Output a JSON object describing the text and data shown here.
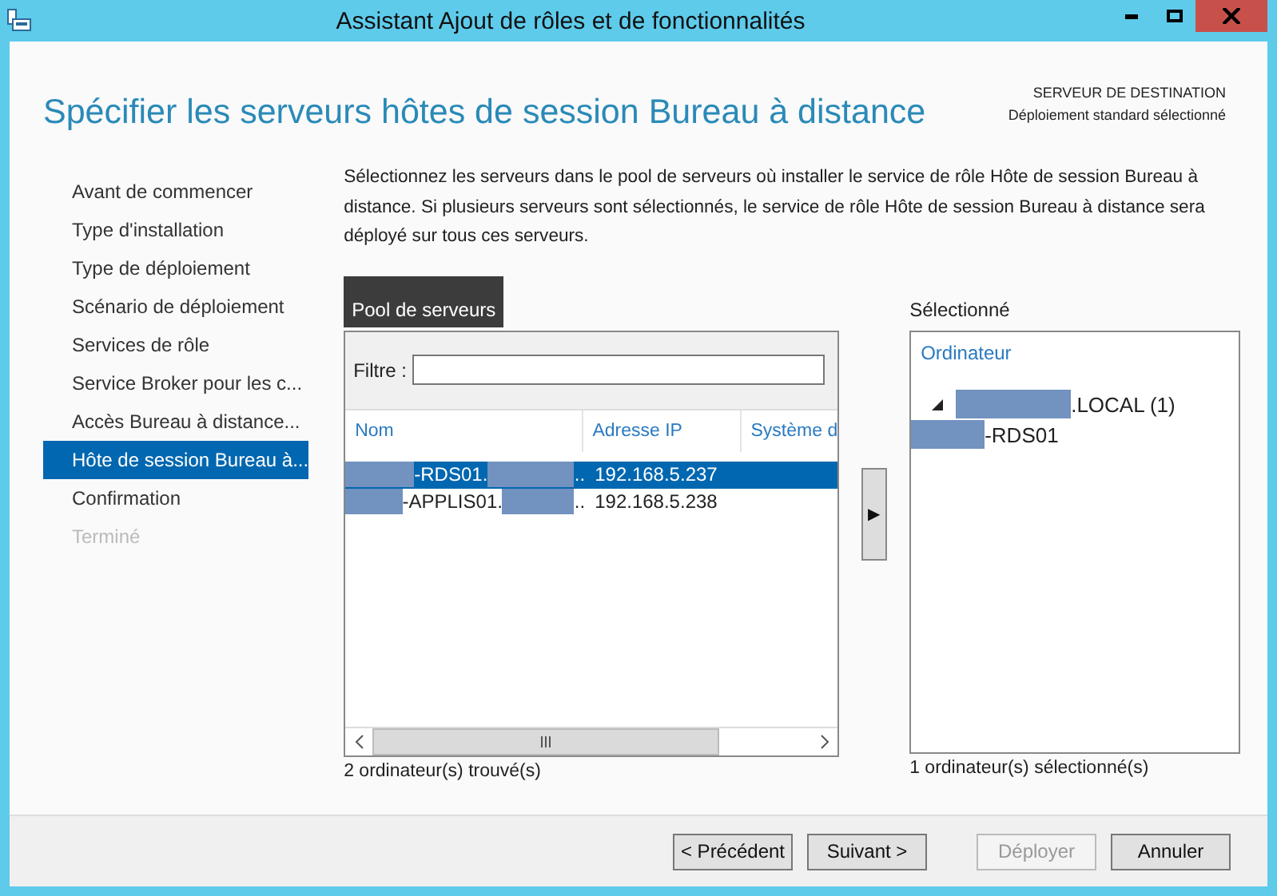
{
  "window": {
    "title": "Assistant Ajout de rôles et de fonctionnalités"
  },
  "header": {
    "title": "Spécifier les serveurs hôtes de session Bureau à distance",
    "destination_label": "SERVEUR DE DESTINATION",
    "destination_value": "Déploiement standard sélectionné"
  },
  "steps": [
    {
      "label": "Avant de commencer",
      "selected": false,
      "disabled": false
    },
    {
      "label": "Type d'installation",
      "selected": false,
      "disabled": false
    },
    {
      "label": "Type de déploiement",
      "selected": false,
      "disabled": false
    },
    {
      "label": "Scénario de déploiement",
      "selected": false,
      "disabled": false
    },
    {
      "label": "Services de rôle",
      "selected": false,
      "disabled": false
    },
    {
      "label": "Service Broker pour les c...",
      "selected": false,
      "disabled": false
    },
    {
      "label": "Accès Bureau à distance...",
      "selected": false,
      "disabled": false
    },
    {
      "label": "Hôte de session Bureau à...",
      "selected": true,
      "disabled": false
    },
    {
      "label": "Confirmation",
      "selected": false,
      "disabled": false
    },
    {
      "label": "Terminé",
      "selected": false,
      "disabled": true
    }
  ],
  "description": "Sélectionnez les serveurs dans le pool de serveurs où installer le service de rôle Hôte de session Bureau à distance. Si plusieurs serveurs sont sélectionnés, le service de rôle Hôte de session Bureau à distance sera déployé sur tous ces serveurs.",
  "pool": {
    "tab": "Pool de serveurs",
    "filter_label": "Filtre :",
    "columns": [
      "Nom",
      "Adresse IP",
      "Système d"
    ],
    "rows": [
      {
        "selected": true,
        "name": [
          {
            "kind": "redacted"
          },
          {
            "kind": "text",
            "text": "-RDS01."
          },
          {
            "kind": "redacted"
          },
          {
            "kind": "text",
            "text": ".."
          }
        ],
        "ip": "192.168.5.237"
      },
      {
        "selected": false,
        "name": [
          {
            "kind": "redacted"
          },
          {
            "kind": "text",
            "text": "-APPLIS01."
          },
          {
            "kind": "redacted"
          },
          {
            "kind": "text",
            "text": ".."
          }
        ],
        "ip": "192.168.5.238"
      }
    ],
    "count": "2 ordinateur(s) trouvé(s)"
  },
  "add_button": "▶",
  "selected_panel": {
    "label": "Sélectionné",
    "column": "Ordinateur",
    "tree": [
      {
        "expanded": true,
        "name": [
          {
            "kind": "redacted"
          },
          {
            "kind": "text",
            "text": ".LOCAL (1)"
          }
        ],
        "children": [
          {
            "name": [
              {
                "kind": "redacted"
              },
              {
                "kind": "text",
                "text": "-RDS01"
              }
            ]
          }
        ]
      }
    ],
    "count": "1 ordinateur(s) sélectionné(s)"
  },
  "buttons": [
    {
      "label": "< Précédent",
      "disabled": false
    },
    {
      "label": "Suivant >",
      "disabled": false
    },
    {
      "label": "Déployer",
      "disabled": true
    },
    {
      "label": "Annuler",
      "disabled": false
    }
  ]
}
